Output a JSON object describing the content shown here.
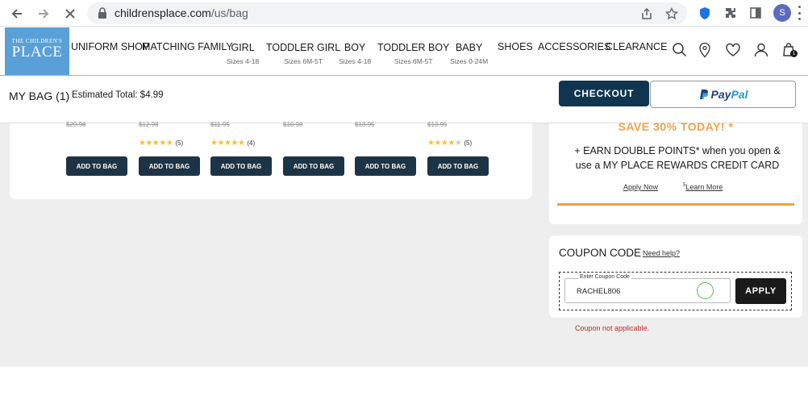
{
  "browser": {
    "url_host": "childrensplace.com",
    "url_path": "/us/bag",
    "profile_initial": "S"
  },
  "site": {
    "logo_small": "THE CHILDREN'S",
    "logo_big": "PLACE",
    "nav": [
      {
        "label": "UNIFORM SHOP",
        "sub": ""
      },
      {
        "label": "MATCHING FAMILY",
        "sub": ""
      },
      {
        "label": "GIRL",
        "sub": "Sizes 4-18"
      },
      {
        "label": "TODDLER GIRL",
        "sub": "Sizes 6M-5T"
      },
      {
        "label": "BOY",
        "sub": "Sizes 4-18"
      },
      {
        "label": "TODDLER BOY",
        "sub": "Sizes 6M-5T"
      },
      {
        "label": "BABY",
        "sub": "Sizes 0-24M"
      },
      {
        "label": "SHOES",
        "sub": ""
      },
      {
        "label": "ACCESSORIES",
        "sub": ""
      },
      {
        "label": "CLEARANCE",
        "sub": ""
      }
    ],
    "bag_count": "1"
  },
  "bag": {
    "title": "MY BAG (1)",
    "estimated_total": "Estimated Total: $4.99",
    "checkout_label": "CHECKOUT",
    "paypal_label_1": "Pay",
    "paypal_label_2": "Pal"
  },
  "products": [
    {
      "price": "$29.98",
      "rating": 0,
      "reviews": "",
      "atb": "ADD TO BAG"
    },
    {
      "price": "$12.98",
      "rating": 4.5,
      "reviews": "(5)",
      "atb": "ADD TO BAG"
    },
    {
      "price": "$11.95",
      "rating": 5,
      "reviews": "(4)",
      "atb": "ADD TO BAG"
    },
    {
      "price": "$10.98",
      "rating": 0,
      "reviews": "",
      "atb": "ADD TO BAG"
    },
    {
      "price": "$13.95",
      "rating": 0,
      "reviews": "",
      "atb": "ADD TO BAG"
    },
    {
      "price": "$13.95",
      "rating": 4,
      "reviews": "(5)",
      "atb": "ADD TO BAG"
    }
  ],
  "rewards": {
    "save_text": "SAVE 30% TODAY! *",
    "earn_line1": "+ EARN DOUBLE POINTS* when you open &",
    "earn_line2": "use a MY PLACE REWARDS CREDIT CARD",
    "apply_now": "Apply Now",
    "learn_more_prefix": "5",
    "learn_more": "Learn More"
  },
  "coupon": {
    "title": "COUPON CODE",
    "need_help": "Need help?",
    "input_label": "Enter Coupon Code",
    "input_value": "RACHEL806",
    "apply_label": "APPLY",
    "error": "Coupon not applicable."
  },
  "colors": {
    "brand_blue": "#5aa0d8",
    "checkout_navy": "#0f3551",
    "reward_orange": "#e8a33c",
    "error_red": "#c0282d"
  }
}
